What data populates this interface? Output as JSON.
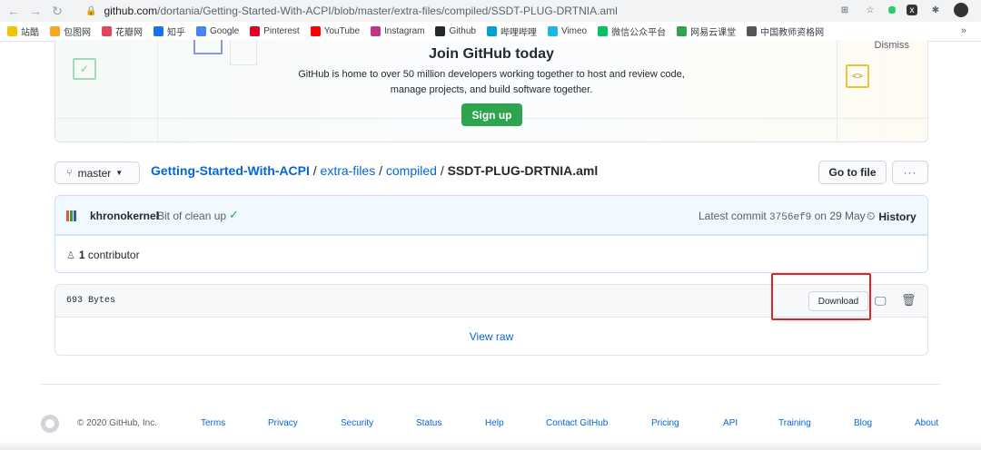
{
  "browser": {
    "url_host": "github.com",
    "url_path": "/dortania/Getting-Started-With-ACPI/blob/master/extra-files/compiled/SSDT-PLUG-DRTNIA.aml",
    "bookmarks": [
      {
        "label": "站酷",
        "color": "#f5c400"
      },
      {
        "label": "包图网",
        "color": "#f6a623"
      },
      {
        "label": "花瓣网",
        "color": "#e5455a"
      },
      {
        "label": "知乎",
        "color": "#1772f6"
      },
      {
        "label": "Google",
        "color": "#4285f4"
      },
      {
        "label": "Pinterest",
        "color": "#e60023"
      },
      {
        "label": "YouTube",
        "color": "#ff0000"
      },
      {
        "label": "Instagram",
        "color": "#c13584"
      },
      {
        "label": "Github",
        "color": "#24292e"
      },
      {
        "label": "哔哩哔哩",
        "color": "#00a1d6"
      },
      {
        "label": "Vimeo",
        "color": "#1ab7ea"
      },
      {
        "label": "微信公众平台",
        "color": "#07c160"
      },
      {
        "label": "网易云课堂",
        "color": "#2fa34f"
      },
      {
        "label": "中国教师资格网",
        "color": "#555555"
      }
    ],
    "bookmarks_more": "»"
  },
  "banner": {
    "title": "Join GitHub today",
    "line1": "GitHub is home to over 50 million developers working together to host and review code,",
    "line2": "manage projects, and build software together.",
    "signup_label": "Sign up",
    "dismiss_label": "Dismiss"
  },
  "repo": {
    "branch": "master",
    "repo_name": "Getting-Started-With-ACPI",
    "path_1": "extra-files",
    "path_2": "compiled",
    "file_name": "SSDT-PLUG-DRTNIA.aml",
    "separator": "/",
    "goto_label": "Go to file",
    "more_label": "···"
  },
  "commit": {
    "author": "khronokernel",
    "message": "Bit of clean up",
    "latest_label": "Latest commit",
    "sha": "3756ef9",
    "date": "on 29 May",
    "history_label": "History",
    "contributor_count": "1",
    "contributor_label": "contributor"
  },
  "file": {
    "size": "693 Bytes",
    "download_label": "Download",
    "view_raw_label": "View raw"
  },
  "footer": {
    "copyright": "© 2020 GitHub, Inc.",
    "links": [
      "Terms",
      "Privacy",
      "Security",
      "Status",
      "Help",
      "Contact GitHub",
      "Pricing",
      "API",
      "Training",
      "Blog",
      "About"
    ]
  },
  "colors": {
    "link": "#0366d6",
    "signup_green": "#2ea44f",
    "highlight_red": "#e02424",
    "check_green": "#28a745"
  }
}
